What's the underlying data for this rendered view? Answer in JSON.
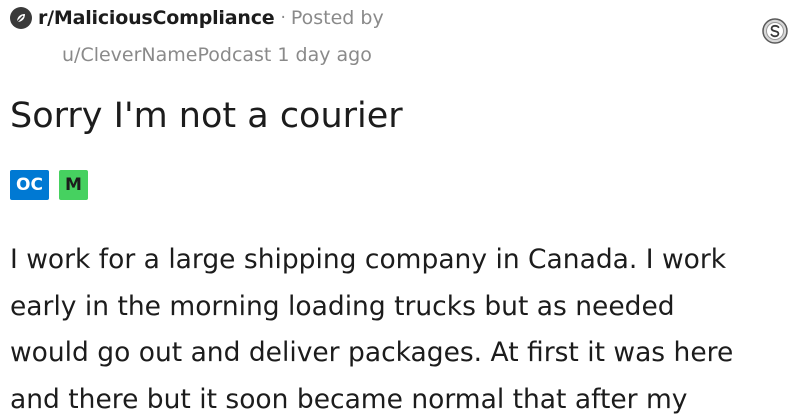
{
  "post": {
    "subreddit": "r/MaliciousCompliance",
    "separator": "·",
    "posted_by": "Posted by",
    "author": "u/CleverNamePodcast",
    "age": "1 day ago",
    "title": "Sorry I'm not a courier",
    "flairs": [
      "OC",
      "M"
    ],
    "body_lines": [
      "I work for a large shipping company in Canada. I work",
      "early in the morning loading trucks but as needed",
      "would go out and deliver packages. At first it was here",
      "and there but it soon became normal that after my"
    ],
    "award_icon": "silver-award-icon",
    "subreddit_icon": "subreddit-icon"
  },
  "colors": {
    "text": "#1c1c1c",
    "meta": "#8a8a8a",
    "flair_oc": "#0079d3",
    "flair_m": "#46d160"
  }
}
